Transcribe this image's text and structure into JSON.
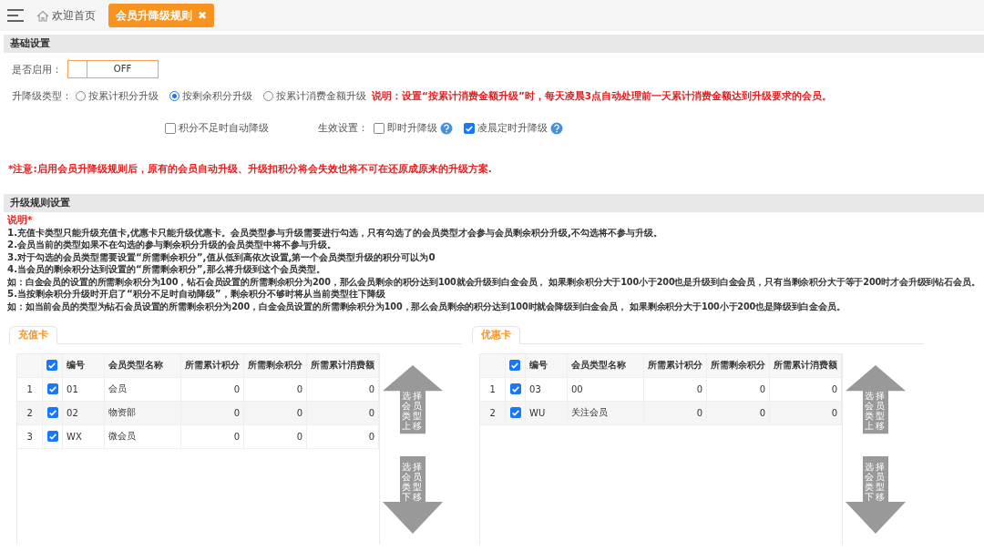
{
  "tabs": [
    {
      "label": "欢迎首页",
      "kind": "home",
      "selected": false
    },
    {
      "label": "会员升降级规则",
      "kind": "page",
      "selected": true,
      "close": "✖"
    }
  ],
  "basic_settings": {
    "title": "基础设置",
    "enable": {
      "label": "是否启用：",
      "toggle": "OFF",
      "on": false
    },
    "upgrade_type": {
      "label": "升降级类型：",
      "options": [
        {
          "label": "按累计积分升级",
          "selected": false
        },
        {
          "label": "按剩余积分升级",
          "selected": true
        },
        {
          "label": "按累计消费金额升级",
          "selected": false
        }
      ],
      "note": "说明：设置“按累计消费金额升级”时，每天凌晨3点自动处理前一天累计消费金额达到升级要求的会员。"
    },
    "auto_downgrade": {
      "label": "积分不足时自动降级",
      "checked": false
    },
    "effect": {
      "label": "生效设置：",
      "options": [
        {
          "label": "即时升降级",
          "checked": false
        },
        {
          "label": "凌晨定时升降级",
          "checked": true
        }
      ]
    },
    "warning": "*注意:启用会员升降级规则后，原有的会员自动升级、升级扣积分将会失效也将不可在还原成原来的升级方案."
  },
  "rules": {
    "title": "升级规则设置",
    "heading": "说明*",
    "lines": [
      "1.充值卡类型只能升级充值卡,优惠卡只能升级优惠卡。会员类型参与升级需要进行勾选，只有勾选了的会员类型才会参与会员剩余积分升级,不勾选将不参与升级。",
      "2.会员当前的类型如果不在勾选的参与剩余积分升级的会员类型中将不参与升级。",
      "3.对于勾选的会员类型需要设置“所需剩余积分”,值从低到高依次设置,第一个会员类型升级的积分可以为0",
      "4.当会员的剩余积分达到设置的“所需剩余积分”,那么将升级到这个会员类型。",
      "如：白金会员的设置的所需剩余积分为100，钻石会员设置的所需剩余积分为200，那么会员剩余的积分达到100就会升级到白金会员， 如果剩余积分大于100小于200也是升级到白金会员，只有当剩余积分大于等于200时才会升级到钻石会员。",
      "5.当按剩余积分升级时开启了“积分不足时自动降级”，剩余积分不够时将从当前类型往下降级",
      "如：如当前会员的类型为钻石会员设置的所需剩余积分为200，白金会员设置的所需剩余积分为100，那么会员剩余的积分达到100时就会降级到白金会员， 如果剩余积分大于100小于200也是降级到白金会员。"
    ]
  },
  "panels": [
    {
      "tab": "充值卡",
      "all_checked": true,
      "columns": [
        "编号",
        "会员类型名称",
        "所需累计积分",
        "所需剩余积分",
        "所需累计消费额"
      ],
      "rows": [
        {
          "index": "1",
          "checked": true,
          "cells": [
            "01",
            "会员",
            "0",
            "0",
            "0"
          ]
        },
        {
          "index": "2",
          "checked": true,
          "cells": [
            "02",
            "物资部",
            "0",
            "0",
            "0"
          ]
        },
        {
          "index": "3",
          "checked": true,
          "cells": [
            "WX",
            "微会员",
            "0",
            "0",
            "0"
          ]
        }
      ],
      "move_up": "选择会员类型上移",
      "move_down": "选择会员类型下移"
    },
    {
      "tab": "优惠卡",
      "all_checked": true,
      "columns": [
        "编号",
        "会员类型名称",
        "所需累计积分",
        "所需剩余积分",
        "所需累计消费额"
      ],
      "rows": [
        {
          "index": "1",
          "checked": true,
          "cells": [
            "03",
            "00",
            "0",
            "0",
            "0"
          ]
        },
        {
          "index": "2",
          "checked": true,
          "cells": [
            "WU",
            "关注会员",
            "0",
            "0",
            "0"
          ]
        }
      ],
      "move_up": "选择会员类型上移",
      "move_down": "选择会员类型下移"
    }
  ]
}
